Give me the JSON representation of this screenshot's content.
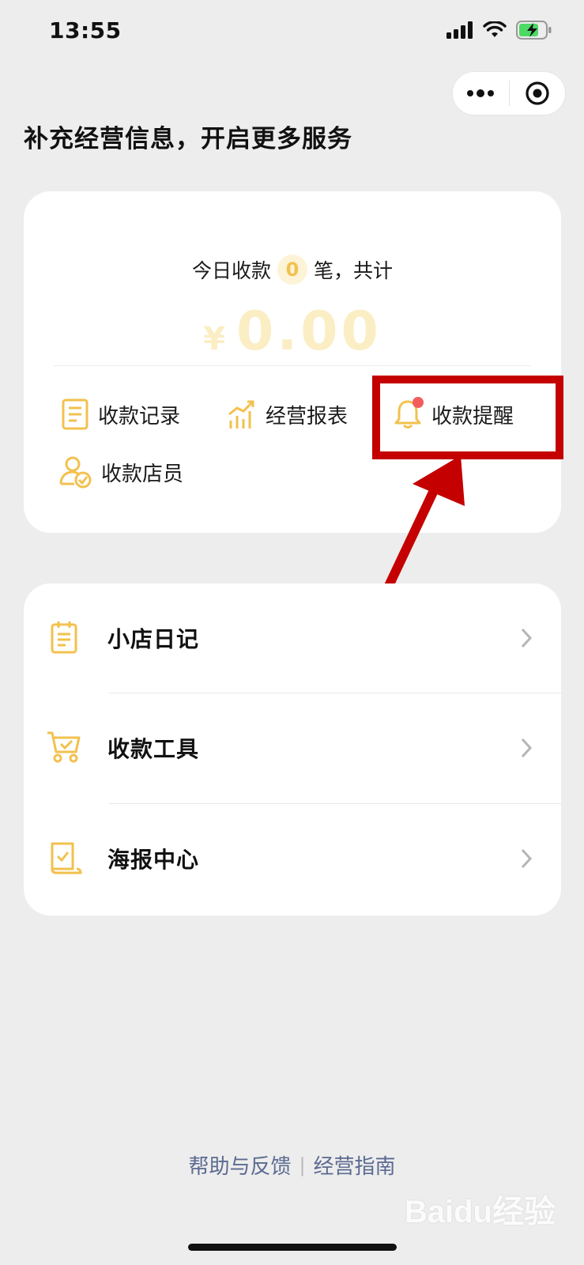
{
  "status_bar": {
    "time": "13:55"
  },
  "capsule": {
    "more_icon": "more-dots-icon",
    "close_icon": "target-close-icon"
  },
  "banner": {
    "title": "补充经营信息，开启更多服务"
  },
  "summary": {
    "today_prefix": "今日收款",
    "count": "0",
    "today_suffix": "笔，共计",
    "currency": "¥",
    "amount": "0.00"
  },
  "shortcuts": [
    {
      "label": "收款记录",
      "icon": "receipt-icon"
    },
    {
      "label": "经营报表",
      "icon": "chart-icon"
    },
    {
      "label": "收款提醒",
      "icon": "bell-icon"
    },
    {
      "label": "收款店员",
      "icon": "staff-icon"
    }
  ],
  "menu": [
    {
      "label": "小店日记",
      "icon": "diary-icon"
    },
    {
      "label": "收款工具",
      "icon": "cart-icon"
    },
    {
      "label": "海报中心",
      "icon": "poster-icon"
    }
  ],
  "footer": {
    "help": "帮助与反馈",
    "separator": "|",
    "guide": "经营指南"
  },
  "watermark": "Baidu经验",
  "colors": {
    "accent": "#f2c14e",
    "highlight": "#c40000",
    "link": "#5b6a91"
  }
}
